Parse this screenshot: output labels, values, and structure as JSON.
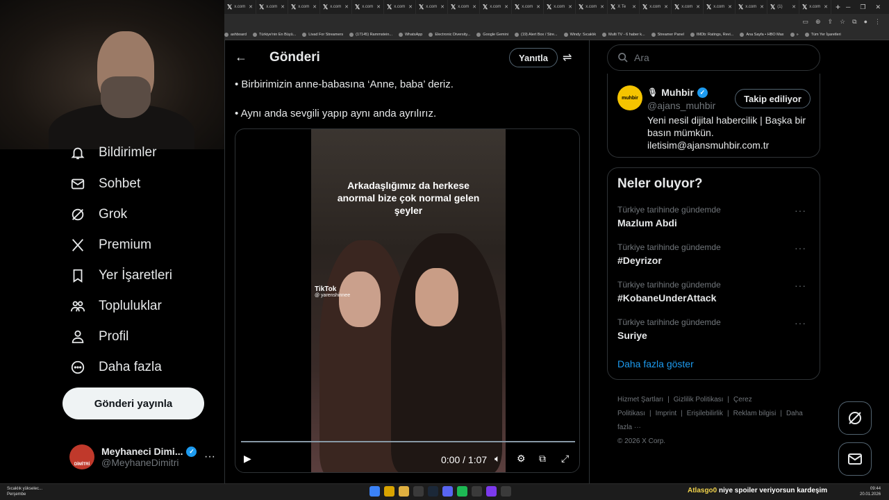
{
  "browser": {
    "tabs": [
      "x.com",
      "x.com",
      "x.com",
      "x.com",
      "x.com",
      "x.com",
      "x.com",
      "x.com",
      "x.com",
      "x.com",
      "x.com",
      "x.com",
      "X Te",
      "x.com",
      "x.com",
      "x.com",
      "x.com",
      "(1) ",
      "x.com"
    ],
    "new_tab": "+",
    "bookmarks": [
      "ashboard",
      "Türkiye'nin En Büyü...",
      "Livad For Streamers",
      "(17145) Rammstein...",
      "WhatsApp",
      "Electronic Diversity...",
      "Google Gemini",
      "(19) Alert Box / Stre...",
      "Windy: Sıcaklık",
      "Multi TV - 6 haber k...",
      "Streamer Panel",
      "IMDb: Ratings, Revi...",
      "Ana Sayfa • HBO Max",
      "»",
      "Tüm Yer İşaretleri"
    ]
  },
  "sidebar": {
    "items": [
      {
        "label": "Bildirimler",
        "icon": "bell-icon"
      },
      {
        "label": "Sohbet",
        "icon": "mail-icon"
      },
      {
        "label": "Grok",
        "icon": "grok-icon"
      },
      {
        "label": "Premium",
        "icon": "x-logo-icon"
      },
      {
        "label": "Yer İşaretleri",
        "icon": "bookmark-icon"
      },
      {
        "label": "Topluluklar",
        "icon": "communities-icon"
      },
      {
        "label": "Profil",
        "icon": "profile-icon"
      },
      {
        "label": "Daha fazla",
        "icon": "more-circle-icon"
      }
    ],
    "post_button": "Gönderi yayınla",
    "account": {
      "name": "Meyhaneci Dimi...",
      "handle": "@MeyhaneDimitri",
      "avatar_text": "DİMİTRİ"
    }
  },
  "main": {
    "title": "Gönderi",
    "reply_button": "Yanıtla",
    "post_lines": [
      "• Birbirimizin anne-babasına ‘Anne, baba’ deriz.",
      "• Aynı anda sevgili yapıp aynı anda ayrılırız."
    ],
    "video": {
      "caption": "Arkadaşlığımız da herkese anormal bize çok normal gelen şeyler",
      "watermark": "TikTok",
      "watermark_user": "@ yarenshinnee",
      "time": "0:00 / 1:07",
      "progress": 0
    }
  },
  "right": {
    "search_placeholder": "Ara",
    "profile": {
      "avatar_text": "muhbir",
      "name": "Muhbir",
      "handle": "@ajans_muhbir",
      "bio": "Yeni nesil dijital habercilik | Başka bir basın mümkün. iletisim@ajansmuhbir.com.tr",
      "follow_button": "Takip ediliyor"
    },
    "trends_title": "Neler oluyor?",
    "trends": [
      {
        "context": "Türkiye tarihinde gündemde",
        "name": "Mazlum Abdi"
      },
      {
        "context": "Türkiye tarihinde gündemde",
        "name": "#Deyrizor"
      },
      {
        "context": "Türkiye tarihinde gündemde",
        "name": "#KobaneUnderAttack"
      },
      {
        "context": "Türkiye tarihinde gündemde",
        "name": "Suriye"
      }
    ],
    "show_more": "Daha fazla göster",
    "footer_links": [
      "Hizmet Şartları",
      "|",
      "Gizlilik Politikası",
      "|",
      "Çerez Politikası",
      "|",
      "Imprint",
      "|",
      "Erişilebilirlik",
      "|",
      "Reklam bilgisi",
      "|",
      "Daha fazla ···"
    ],
    "copyright": "© 2026 X Corp."
  },
  "taskbar": {
    "weather": "Sıcaklık yükselec...",
    "weather_day": "Perşembe",
    "chat_user": "Atlasgo0",
    "chat_msg": "niye spoiler veriyorsun kardeşim",
    "time": "09:44",
    "date": "20.01.2026"
  },
  "colors": {
    "accent": "#1d9bf0",
    "muhbir": "#f5c400"
  }
}
